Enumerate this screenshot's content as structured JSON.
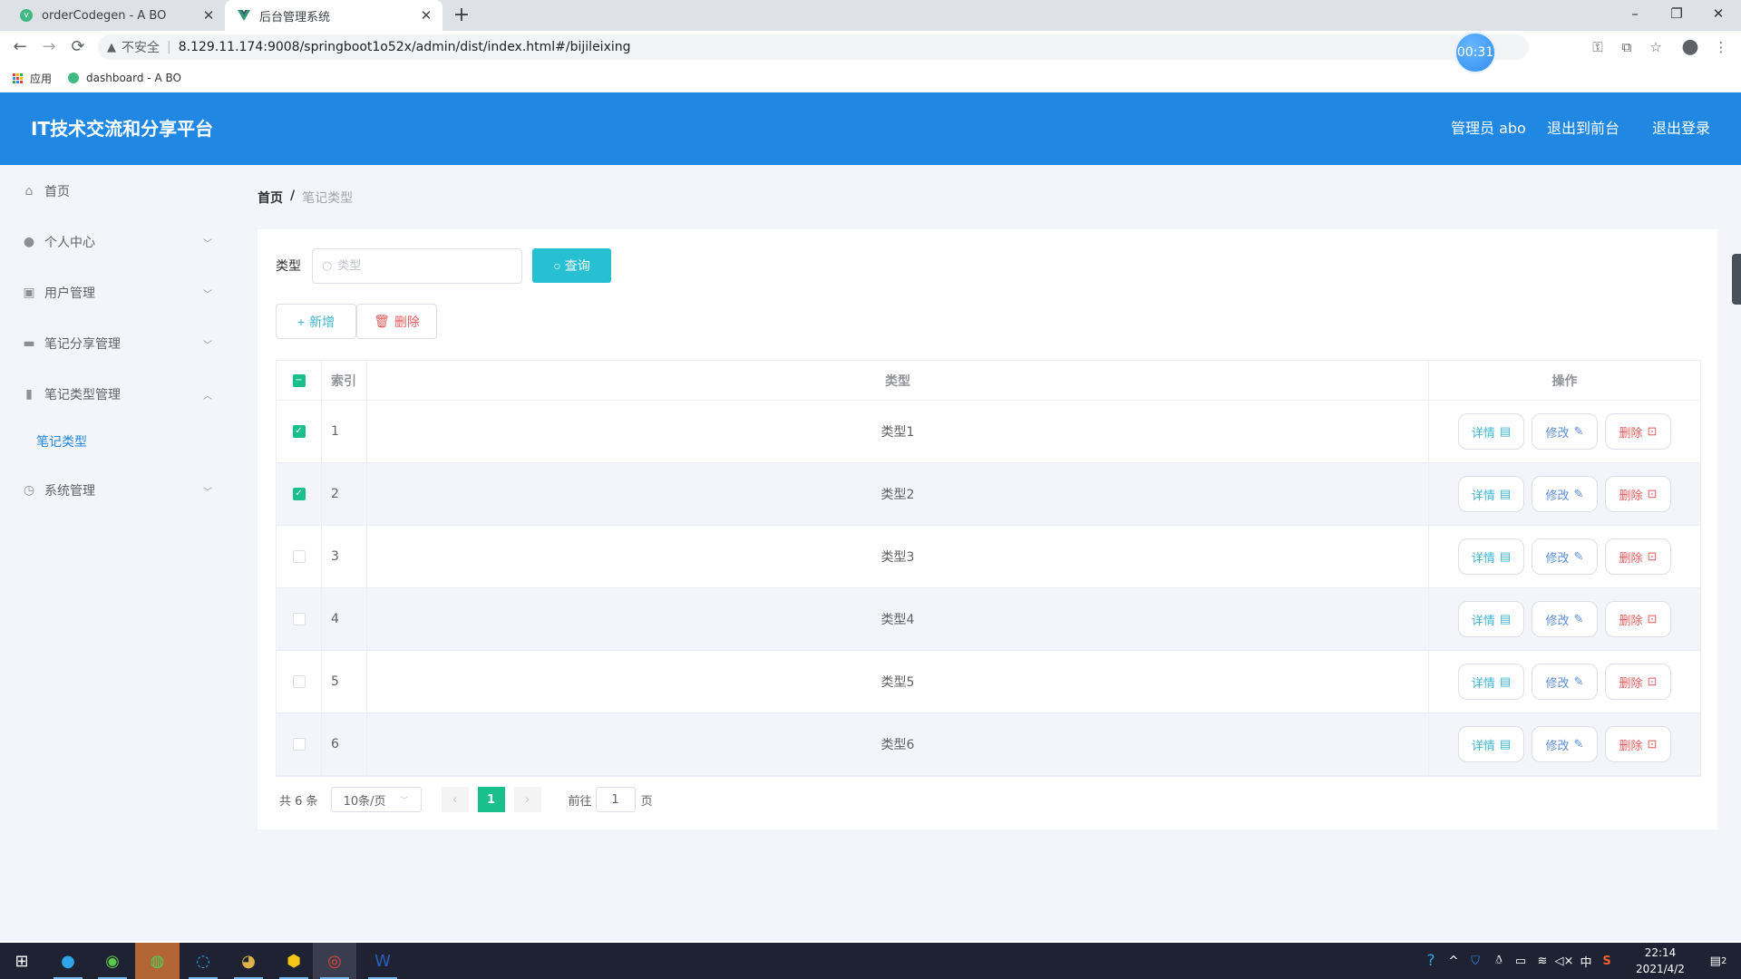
{
  "browser": {
    "tabs": [
      {
        "title": "orderCodegen - A BO",
        "active": false
      },
      {
        "title": "后台管理系统",
        "active": true
      }
    ],
    "new_tab_icon": "plus-icon",
    "window_controls": {
      "minimize": "–",
      "restore": "❐",
      "close": "✕"
    },
    "nav": {
      "back": "←",
      "forward": "→",
      "reload": "⟳"
    },
    "security_label": "不安全",
    "url": "8.129.11.174:9008/springboot1o52x/admin/dist/index.html#/bijileixing",
    "timer_badge": "00:31",
    "toolbar_icons": [
      "key-icon",
      "translate-icon",
      "star-icon",
      "profile-icon",
      "menu-icon"
    ],
    "bookmarks": [
      {
        "label": "应用",
        "icon": "apps-icon"
      },
      {
        "label": "dashboard - A BO",
        "icon": "vue-icon"
      }
    ]
  },
  "header": {
    "brand": "IT技术交流和分享平台",
    "user_label": "管理员 abo",
    "to_front_label": "退出到前台",
    "logout_label": "退出登录",
    "bg_color": "#2088e3"
  },
  "sidebar": {
    "items": [
      {
        "label": "首页",
        "icon": "home-icon",
        "expandable": false
      },
      {
        "label": "个人中心",
        "icon": "user-icon",
        "expandable": true,
        "expanded": false
      },
      {
        "label": "用户管理",
        "icon": "clipboard-icon",
        "expandable": true,
        "expanded": false
      },
      {
        "label": "笔记分享管理",
        "icon": "briefcase-icon",
        "expandable": true,
        "expanded": false
      },
      {
        "label": "笔记类型管理",
        "icon": "book-icon",
        "expandable": true,
        "expanded": true
      },
      {
        "label": "系统管理",
        "icon": "compass-icon",
        "expandable": true,
        "expanded": false
      }
    ],
    "submenu": {
      "label": "笔记类型",
      "active": true
    }
  },
  "breadcrumb": {
    "home": "首页",
    "separator": "/",
    "current": "笔记类型"
  },
  "search": {
    "label": "类型",
    "placeholder": "类型",
    "value": "",
    "query_button": "查询"
  },
  "actions": {
    "add": "新增",
    "delete": "删除"
  },
  "table": {
    "columns": [
      "索引",
      "类型",
      "操作"
    ],
    "header_checkbox": "indeterminate",
    "rows": [
      {
        "index": "1",
        "type": "类型1",
        "checked": true
      },
      {
        "index": "2",
        "type": "类型2",
        "checked": true
      },
      {
        "index": "3",
        "type": "类型3",
        "checked": false
      },
      {
        "index": "4",
        "type": "类型4",
        "checked": false
      },
      {
        "index": "5",
        "type": "类型5",
        "checked": false
      },
      {
        "index": "6",
        "type": "类型6",
        "checked": false
      }
    ],
    "row_actions": {
      "detail": "详情",
      "edit": "修改",
      "remove": "删除"
    }
  },
  "pagination": {
    "total_text": "共 6 条",
    "page_size": "10条/页",
    "current_page": "1",
    "goto_prefix": "前往",
    "goto_value": "1",
    "goto_suffix": "页"
  },
  "taskbar": {
    "apps": [
      "windows-start-icon",
      "edge-icon",
      "browser-360-icon",
      "wechat-icon",
      "qq-browser-icon",
      "game-icon",
      "sketch-icon",
      "chrome-icon",
      "word-icon"
    ],
    "tray_icons": [
      "help-icon",
      "chevron-up-icon",
      "shield-icon",
      "qq-icon",
      "battery-icon",
      "wifi-icon",
      "volume-muted-icon",
      "ime-icon",
      "sogou-icon"
    ],
    "ime_label": "中",
    "time": "22:14",
    "date": "2021/4/2",
    "notification_count": "2"
  }
}
